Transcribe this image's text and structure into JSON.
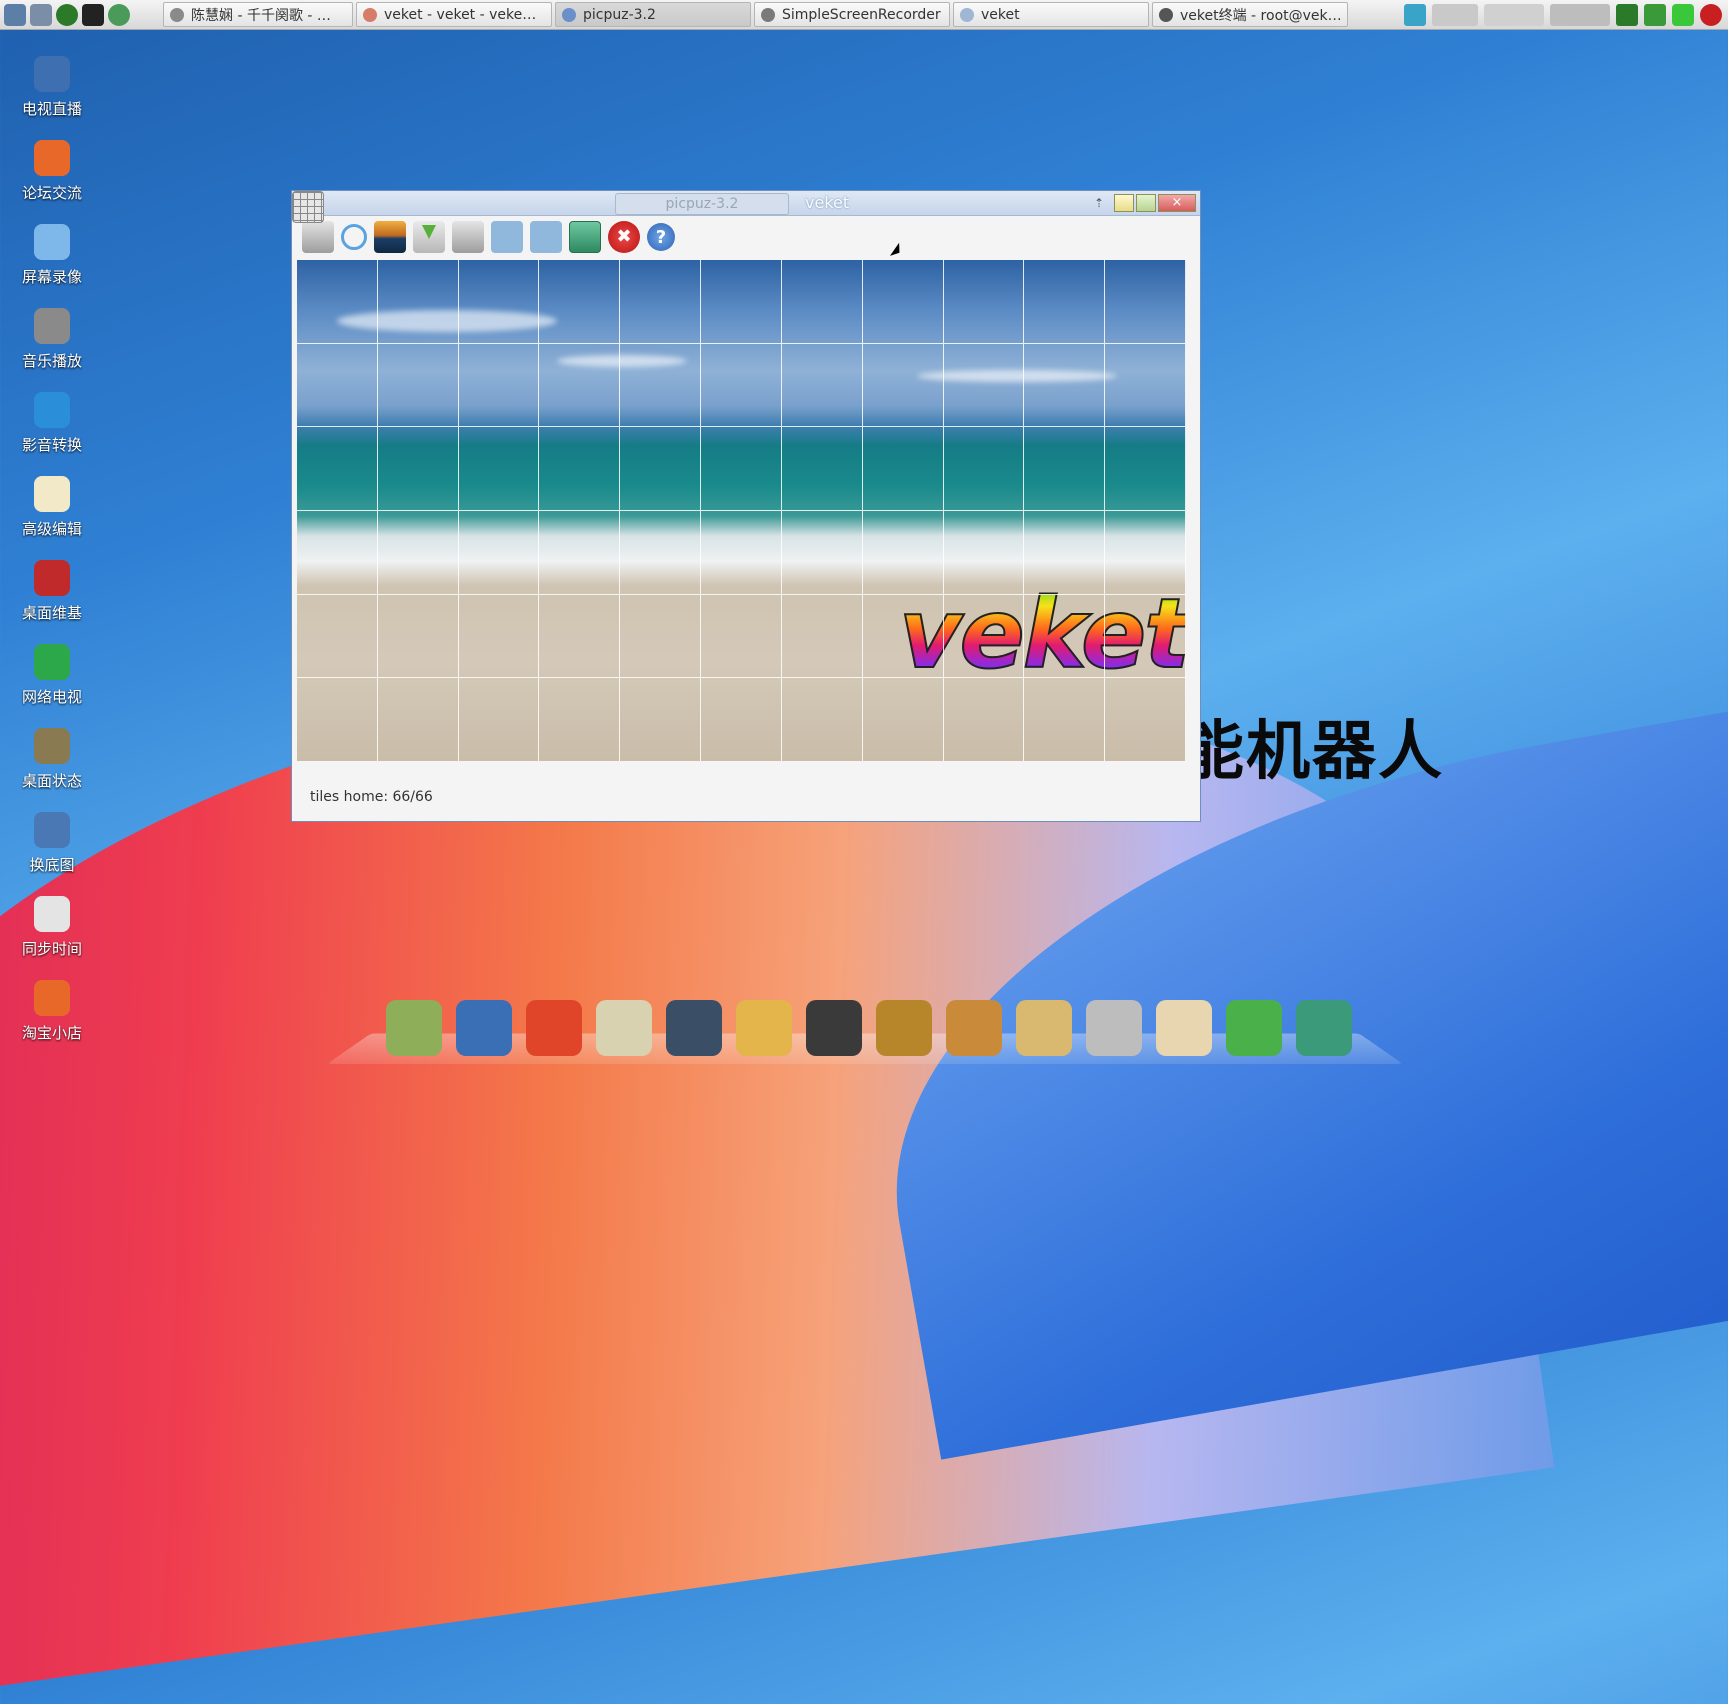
{
  "taskbar": {
    "tasks": [
      {
        "label": "陈慧娴 - 千千阕歌 - …",
        "color": "#8a8a8a"
      },
      {
        "label": "veket - veket - veke…",
        "color": "#d77b6a"
      },
      {
        "label": "picpuz-3.2",
        "color": "#6b8fc8",
        "active": true
      },
      {
        "label": "SimpleScreenRecorder",
        "color": "#7a7a7a"
      },
      {
        "label": "veket",
        "color": "#9fb6d4"
      },
      {
        "label": "veket终端 - root@vek…",
        "color": "#555"
      }
    ]
  },
  "desktop": {
    "background_text": "能机器人",
    "icons": [
      {
        "label": "电视直播",
        "icon": "tv-icon",
        "color": "#3e6fb0"
      },
      {
        "label": "论坛交流",
        "icon": "firefox-icon",
        "color": "#e8682a"
      },
      {
        "label": "屏幕录像",
        "icon": "recorder-icon",
        "color": "#7eb8ea"
      },
      {
        "label": "音乐播放",
        "icon": "speaker-icon",
        "color": "#8a8a8a"
      },
      {
        "label": "影音转换",
        "icon": "media-convert-icon",
        "color": "#2a8ed8"
      },
      {
        "label": "高级编辑",
        "icon": "notepad-icon",
        "color": "#f2e9c8"
      },
      {
        "label": "桌面维基",
        "icon": "wiki-icon",
        "color": "#c02a2a"
      },
      {
        "label": "网络电视",
        "icon": "play-icon",
        "color": "#2ca84a"
      },
      {
        "label": "桌面状态",
        "icon": "status-icon",
        "color": "#8a7a52"
      },
      {
        "label": "换底图",
        "icon": "monitor-icon",
        "color": "#4a78b4"
      },
      {
        "label": "同步时间",
        "icon": "calendar-icon",
        "color": "#e4e4e4"
      },
      {
        "label": "淘宝小店",
        "icon": "firefox-icon",
        "color": "#e8682a"
      }
    ]
  },
  "window": {
    "tab_label": "picpuz-3.2",
    "title": "veket",
    "close_label": "×",
    "status": "tiles home: 66/66",
    "logo_text": "veket",
    "toolbar": {
      "tools": [
        {
          "name": "open-file-icon",
          "style": "grey"
        },
        {
          "name": "tile-grid-icon",
          "style": "grid"
        },
        {
          "name": "refresh-icon",
          "style": "refresh"
        },
        {
          "name": "image-icon",
          "style": "photo"
        },
        {
          "name": "download-icon",
          "style": "dl"
        },
        {
          "name": "open-file-2-icon",
          "style": "grey"
        },
        {
          "name": "puzzle-piece-icon",
          "style": "puz"
        },
        {
          "name": "puzzle-piece-2-icon",
          "style": "puz"
        },
        {
          "name": "settings-bar-icon",
          "style": "bar"
        }
      ],
      "quit_symbol": "✖",
      "help_symbol": "?"
    },
    "tiles": {
      "rows": 6,
      "cols": 11
    }
  },
  "dock": {
    "items": [
      {
        "name": "file-manager-icon",
        "color": "#8fae5a"
      },
      {
        "name": "display-icon",
        "color": "#3a6fb5"
      },
      {
        "name": "fox-icon",
        "color": "#e0452a"
      },
      {
        "name": "editor-icon",
        "color": "#d8d2b0"
      },
      {
        "name": "media-player-icon",
        "color": "#3a4e66"
      },
      {
        "name": "users-icon",
        "color": "#e3b54a"
      },
      {
        "name": "qq-penguin-icon",
        "color": "#3a3a3a"
      },
      {
        "name": "notebook-icon",
        "color": "#b8862a"
      },
      {
        "name": "chart-icon",
        "color": "#c98a3a"
      },
      {
        "name": "paint-icon",
        "color": "#d9b870"
      },
      {
        "name": "usb-drive-icon",
        "color": "#bdbdbd"
      },
      {
        "name": "veket-box-icon",
        "color": "#e8d6b0"
      },
      {
        "name": "network-icon",
        "color": "#4ab04a"
      },
      {
        "name": "camera-icon",
        "color": "#3a9a7a"
      }
    ]
  }
}
